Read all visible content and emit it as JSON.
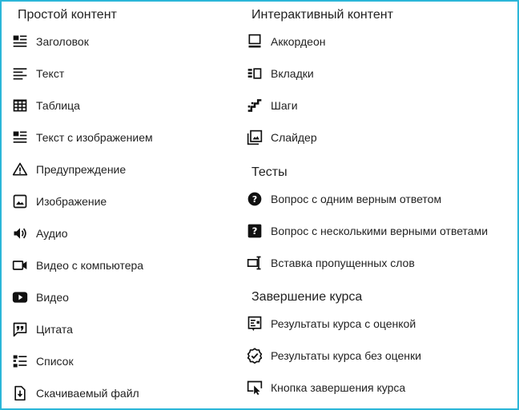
{
  "simple": {
    "title": "Простой контент",
    "items": [
      {
        "label": "Заголовок",
        "icon": "heading-icon"
      },
      {
        "label": "Текст",
        "icon": "text-icon"
      },
      {
        "label": "Таблица",
        "icon": "table-icon"
      },
      {
        "label": "Текст с изображением",
        "icon": "text-with-image-icon"
      },
      {
        "label": "Предупреждение",
        "icon": "warning-icon"
      },
      {
        "label": "Изображение",
        "icon": "image-icon"
      },
      {
        "label": "Аудио",
        "icon": "audio-icon"
      },
      {
        "label": "Видео с компьютера",
        "icon": "video-file-icon"
      },
      {
        "label": "Видео",
        "icon": "video-play-icon"
      },
      {
        "label": "Цитата",
        "icon": "quote-icon"
      },
      {
        "label": "Список",
        "icon": "list-icon"
      },
      {
        "label": "Скачиваемый файл",
        "icon": "download-file-icon"
      }
    ]
  },
  "interactive": {
    "title": "Интерактивный контент",
    "items": [
      {
        "label": "Аккордеон",
        "icon": "accordion-icon"
      },
      {
        "label": "Вкладки",
        "icon": "tabs-icon"
      },
      {
        "label": "Шаги",
        "icon": "steps-icon"
      },
      {
        "label": "Слайдер",
        "icon": "slider-icon"
      }
    ]
  },
  "tests": {
    "title": "Тесты",
    "items": [
      {
        "label": "Вопрос с одним верным ответом",
        "icon": "single-answer-question-icon"
      },
      {
        "label": "Вопрос с несколькими верными ответами",
        "icon": "multiple-answer-question-icon"
      },
      {
        "label": "Вставка пропущенных слов",
        "icon": "fill-in-blanks-icon"
      }
    ]
  },
  "completion": {
    "title": "Завершение курса",
    "items": [
      {
        "label": "Результаты курса с оценкой",
        "icon": "graded-results-icon"
      },
      {
        "label": "Результаты курса без оценки",
        "icon": "ungraded-results-icon"
      },
      {
        "label": "Кнопка завершения курса",
        "icon": "finish-button-icon"
      }
    ]
  },
  "colors": {
    "frame_border": "#2bb6d8",
    "text": "#222222",
    "icon": "#111111"
  }
}
